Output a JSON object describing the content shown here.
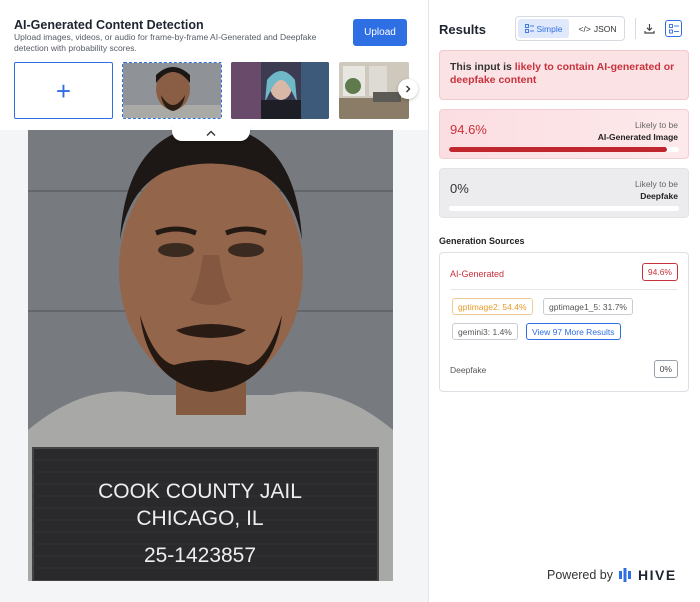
{
  "header": {
    "title": "AI-Generated Content Detection",
    "subtitle": "Upload images, videos, or audio for frame-by-frame AI-Generated and Deepfake detection with probability scores.",
    "upload_label": "Upload"
  },
  "thumbnails": {
    "add_symbol": "+"
  },
  "sign": {
    "line1": "COOK COUNTY JAIL",
    "line2": "CHICAGO, IL",
    "line3": "25-1423857"
  },
  "results": {
    "title": "Results",
    "view_simple": "Simple",
    "view_json": "JSON",
    "verdict_prefix": "This input is ",
    "verdict_highlight": "likely to contain AI-generated or deepfake content",
    "ai_score": {
      "value": "94.6%",
      "fill_percent": 94.6,
      "label_line1": "Likely to be",
      "label_line2": "AI-Generated Image"
    },
    "deepfake_score": {
      "value": "0%",
      "fill_percent": 0,
      "label_line1": "Likely to be",
      "label_line2": "Deepfake"
    }
  },
  "generation_sources": {
    "title": "Generation Sources",
    "ai_label": "AI-Generated",
    "ai_percent": "94.6%",
    "tags": [
      "gptimage2: 54.4%",
      "gptimage1_5: 31.7%",
      "gemini3: 1.4%"
    ],
    "more_results": "View 97 More Results",
    "deepfake_label": "Deepfake",
    "deepfake_percent": "0%"
  },
  "footer": {
    "powered_by": "Powered by",
    "brand": "HIVE"
  },
  "colors": {
    "accent": "#2f6fe4",
    "danger": "#c8323c",
    "warning": "#e69a2b"
  }
}
